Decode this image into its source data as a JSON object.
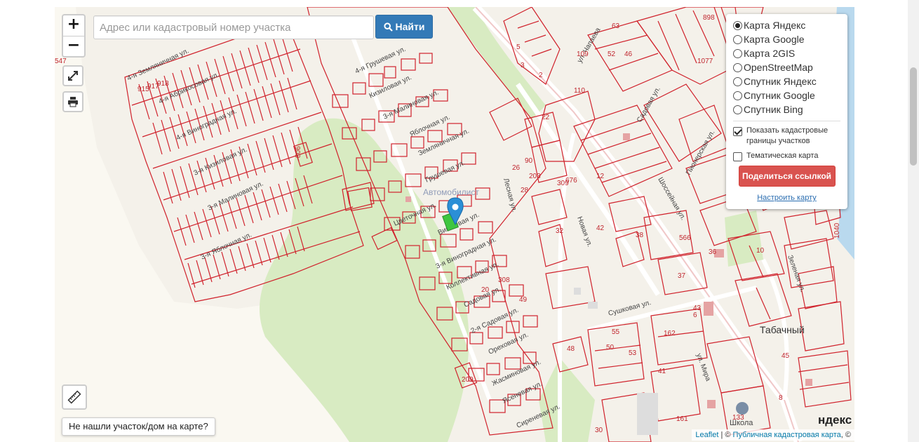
{
  "search": {
    "placeholder": "Адрес или кадастровый номер участка",
    "button_label": "Найти"
  },
  "zoom": {
    "in_label": "+",
    "out_label": "−"
  },
  "layers": {
    "options": [
      {
        "label": "Карта Яндекс",
        "selected": true
      },
      {
        "label": "Карта Google",
        "selected": false
      },
      {
        "label": "Карта 2GIS",
        "selected": false
      },
      {
        "label": "OpenStreetMap",
        "selected": false
      },
      {
        "label": "Спутник Яндекс",
        "selected": false
      },
      {
        "label": "Спутник Google",
        "selected": false
      },
      {
        "label": "Спутник Bing",
        "selected": false
      }
    ],
    "show_boundaries": {
      "label": "Показать кадастровые границы участков",
      "checked": true
    },
    "thematic": {
      "label": "Тематическая карта",
      "checked": false
    },
    "share_label": "Поделиться ссылкой",
    "configure_label": "Настроить карту"
  },
  "not_found_label": "Не нашли участок/дом на карте?",
  "attribution": {
    "leaflet": "Leaflet",
    "sep": " | © ",
    "source": "Публичная кадастровая карта",
    "tail": ", ©"
  },
  "map": {
    "yandex_logo": "ндекс",
    "district_label": "Автомобилист",
    "place_labels": {
      "tabachny": "Табачный",
      "school": "Школа"
    },
    "streets": {
      "zemlyanichnaya4": "4-я Земляничная ул.",
      "abrikosovaya4": "4-я Абрикосовая ул.",
      "vinogradnaya4": "4-я Виноградная ул.",
      "kizilovaya3": "3-я Кизиловая ул.",
      "malinovaya3": "3-я Малиновая ул.",
      "yablochnaya3": "3-я Яблочная ул.",
      "grushevaya4": "4-я Грушевая ул.",
      "kizilovaya": "Кизиловая ул.",
      "malinovaya3b": "3-я Малиновая ул.",
      "yablochnaya": "Яблочная ул.",
      "zemlyanichnaya": "Земляничная ул.",
      "grushevaya": "Грушевая ул.",
      "tsvetochnaya": "Цветочная ул.",
      "vishnevaya": "Вишневая ул.",
      "vinogradnaya3": "3-я Виноградная ул.",
      "kollektivnaya": "Коллективная ул.",
      "sadovaya": "Садовая ул.",
      "sadovaya2": "2-я Садовая ул.",
      "orekhovaya": "Ореховая ул.",
      "zhasminovaya": "Жасминовая ул.",
      "yasenevaya": "Ясеневая ул.",
      "sirenevaya": "Сиреневая ул.",
      "lesnaya": "Лесная ул.",
      "novaya": "Новая ул.",
      "sushkovaya": "Сушковая ул.",
      "chapaeva": "ул. Чапаева",
      "sadovaya_e": "Садовая ул.",
      "pionerskaya": "Пионерская ул.",
      "shosseynaya": "Шоссейная ул.",
      "mira": "ул. Мира",
      "zelenaya": "Зеленая ул."
    },
    "parcel_numbers": {
      "n898": "898",
      "n1077": "1077",
      "n1040": "1040",
      "n806": "806",
      "n309": "309",
      "n308": "308",
      "n209": "209",
      "n203": "203",
      "n162": "162",
      "n161": "161",
      "n133": "133",
      "n110": "110",
      "n109": "109",
      "n90": "90",
      "n676": "676",
      "n566": "566",
      "n547": "547",
      "n915": "915",
      "n917": "917",
      "n918": "918",
      "n63": "63",
      "n52": "52",
      "n46": "46",
      "n48": "48",
      "n55": "55",
      "n50": "50",
      "n53": "53",
      "n41": "41",
      "n36": "36",
      "n37": "37",
      "n38": "38",
      "n32": "32",
      "n28": "28",
      "n26": "26",
      "n22": "22",
      "n20": "20",
      "n12": "12",
      "n10": "10",
      "n8": "8",
      "n6": "6",
      "n5": "5",
      "n3": "3",
      "n2": "2",
      "n30": "30",
      "n42": "42",
      "n49": "49",
      "n45": "45",
      "n43": "43"
    }
  }
}
